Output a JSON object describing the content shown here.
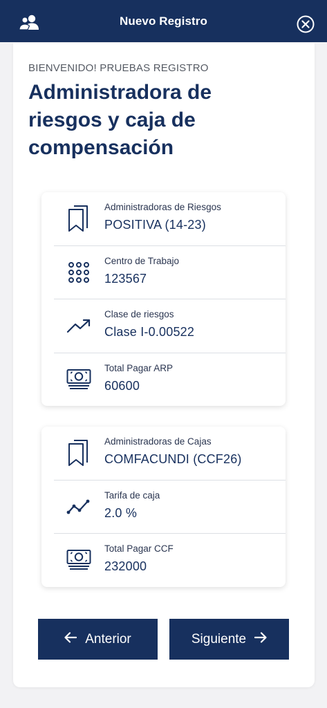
{
  "header": {
    "title": "Nuevo Registro",
    "left_icon": "users-icon",
    "right_icon": "close-circle-icon",
    "color": "#17305e"
  },
  "intro": {
    "welcome": "BIENVENIDO! PRUEBAS REGISTRO",
    "heading": "Administradora de riesgos y caja de compensación"
  },
  "risk_card": {
    "rows": [
      {
        "icon": "bookmarks-icon",
        "label": "Administradoras de Riesgos",
        "value": "POSITIVA (14-23)"
      },
      {
        "icon": "dot-grid-icon",
        "label": "Centro de Trabajo",
        "value": "123567"
      },
      {
        "icon": "trending-up-icon",
        "label": "Clase de riesgos",
        "value": "Clase I-0.00522"
      },
      {
        "icon": "cash-icon",
        "label": "Total Pagar ARP",
        "value": "60600"
      }
    ]
  },
  "caja_card": {
    "rows": [
      {
        "icon": "bookmarks-icon",
        "label": "Administradoras de Cajas",
        "value": "COMFACUNDI (CCF26)"
      },
      {
        "icon": "line-chart-icon",
        "label": "Tarifa de caja",
        "value": "2.0 %"
      },
      {
        "icon": "cash-icon",
        "label": "Total Pagar CCF",
        "value": "232000"
      }
    ]
  },
  "nav": {
    "prev_label": "Anterior",
    "next_label": "Siguiente"
  }
}
